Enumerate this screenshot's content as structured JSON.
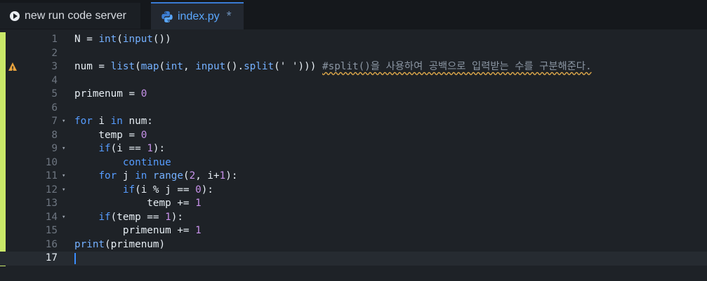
{
  "tabs": [
    {
      "label": "new run code server",
      "icon": "run-icon",
      "active": false
    },
    {
      "label": "index.py",
      "icon": "python-icon",
      "active": true,
      "modified_marker": "*"
    }
  ],
  "editor": {
    "lines": [
      {
        "num": "1",
        "fold": "",
        "warning": false,
        "code": [
          [
            "N = ",
            ""
          ],
          [
            "int",
            "fn"
          ],
          [
            "(",
            ""
          ],
          [
            "input",
            "fn"
          ],
          [
            "())",
            ""
          ]
        ]
      },
      {
        "num": "2",
        "fold": "",
        "warning": false,
        "code": []
      },
      {
        "num": "3",
        "fold": "",
        "warning": true,
        "code": [
          [
            "num = ",
            ""
          ],
          [
            "list",
            "fn"
          ],
          [
            "(",
            ""
          ],
          [
            "map",
            "fn"
          ],
          [
            "(",
            ""
          ],
          [
            "int",
            "fn"
          ],
          [
            ", ",
            ""
          ],
          [
            "input",
            "fn"
          ],
          [
            "().",
            ""
          ],
          [
            "split",
            "fn"
          ],
          [
            "(' ')))",
            ""
          ],
          [
            " ",
            ""
          ],
          [
            "#split()을 사용하여 공백으로 입력받는 수를 구분해준다.",
            "cmt"
          ]
        ]
      },
      {
        "num": "4",
        "fold": "",
        "warning": false,
        "code": []
      },
      {
        "num": "5",
        "fold": "",
        "warning": false,
        "code": [
          [
            "primenum = ",
            ""
          ],
          [
            "0",
            "num"
          ]
        ]
      },
      {
        "num": "6",
        "fold": "",
        "warning": false,
        "code": []
      },
      {
        "num": "7",
        "fold": "▾",
        "warning": false,
        "code": [
          [
            "for",
            "kw"
          ],
          [
            " i ",
            ""
          ],
          [
            "in",
            "kw"
          ],
          [
            " num:",
            ""
          ]
        ]
      },
      {
        "num": "8",
        "fold": "",
        "warning": false,
        "code": [
          [
            "    temp = ",
            ""
          ],
          [
            "0",
            "num"
          ]
        ]
      },
      {
        "num": "9",
        "fold": "▾",
        "warning": false,
        "code": [
          [
            "    ",
            ""
          ],
          [
            "if",
            "kw"
          ],
          [
            "(i == ",
            ""
          ],
          [
            "1",
            "num"
          ],
          [
            "):",
            ""
          ]
        ]
      },
      {
        "num": "10",
        "fold": "",
        "warning": false,
        "code": [
          [
            "        ",
            ""
          ],
          [
            "continue",
            "kw"
          ]
        ]
      },
      {
        "num": "11",
        "fold": "▾",
        "warning": false,
        "code": [
          [
            "    ",
            ""
          ],
          [
            "for",
            "kw"
          ],
          [
            " j ",
            ""
          ],
          [
            "in",
            "kw"
          ],
          [
            " ",
            ""
          ],
          [
            "range",
            "fn"
          ],
          [
            "(",
            ""
          ],
          [
            "2",
            "num"
          ],
          [
            ", i+",
            ""
          ],
          [
            "1",
            "num"
          ],
          [
            "):",
            ""
          ]
        ]
      },
      {
        "num": "12",
        "fold": "▾",
        "warning": false,
        "code": [
          [
            "        ",
            ""
          ],
          [
            "if",
            "kw"
          ],
          [
            "(i % j == ",
            ""
          ],
          [
            "0",
            "num"
          ],
          [
            "):",
            ""
          ]
        ]
      },
      {
        "num": "13",
        "fold": "",
        "warning": false,
        "code": [
          [
            "            temp += ",
            ""
          ],
          [
            "1",
            "num"
          ]
        ]
      },
      {
        "num": "14",
        "fold": "▾",
        "warning": false,
        "code": [
          [
            "    ",
            ""
          ],
          [
            "if",
            "kw"
          ],
          [
            "(temp == ",
            ""
          ],
          [
            "1",
            "num"
          ],
          [
            "):",
            ""
          ]
        ]
      },
      {
        "num": "15",
        "fold": "",
        "warning": false,
        "code": [
          [
            "        primenum += ",
            ""
          ],
          [
            "1",
            "num"
          ]
        ]
      },
      {
        "num": "16",
        "fold": "",
        "warning": false,
        "code": [
          [
            "print",
            "fn"
          ],
          [
            "(primenum)",
            ""
          ]
        ]
      },
      {
        "num": "17",
        "fold": "",
        "warning": false,
        "current": true,
        "code": []
      }
    ]
  }
}
